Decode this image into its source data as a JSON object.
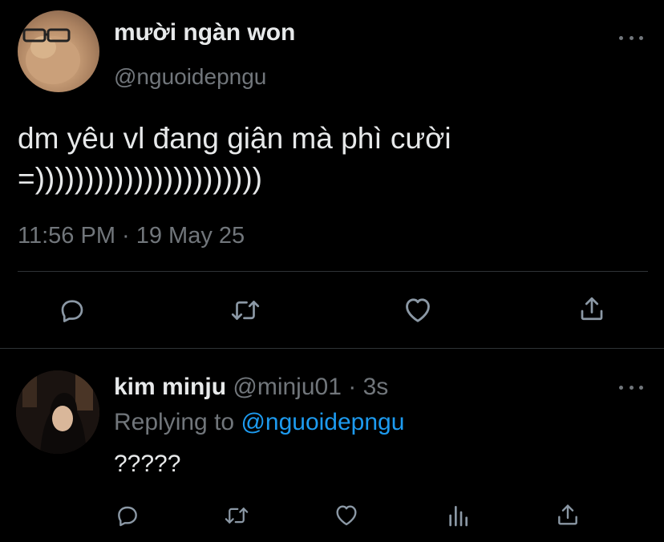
{
  "main_tweet": {
    "display_name": "mười ngàn won",
    "handle": "@nguoidepngu",
    "text": "dm yêu vl đang giận mà phì cười\n=)))))))))))))))))))))))",
    "timestamp": "11:56 PM · 19 May 25",
    "actions": [
      "reply-icon",
      "retweet-icon",
      "like-icon",
      "share-icon"
    ]
  },
  "reply_tweet": {
    "display_name": "kim minju",
    "handle": "@minju01",
    "separator": "·",
    "time": "3s",
    "replying_prefix": "Replying to ",
    "replying_mention": "@nguoidepngu",
    "text": "?????",
    "actions": [
      "reply-icon",
      "retweet-icon",
      "like-icon",
      "views-icon",
      "share-icon"
    ]
  },
  "colors": {
    "background": "#000000",
    "primary_text": "#e7e9ea",
    "secondary_text": "#71767b",
    "link": "#1d9bf0",
    "divider": "#2f3336"
  }
}
